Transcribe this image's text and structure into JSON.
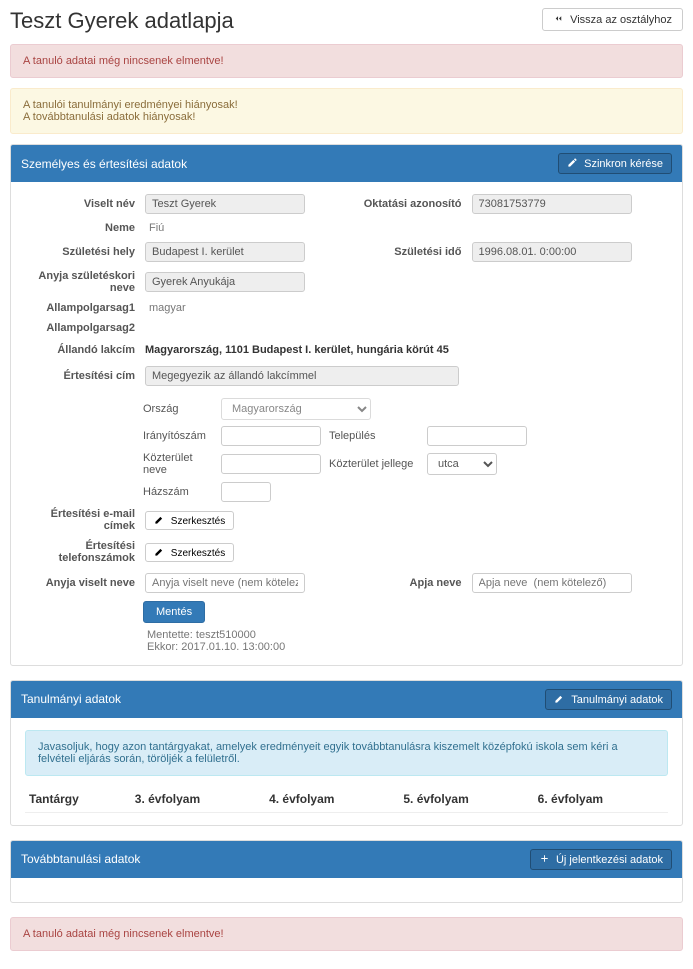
{
  "header": {
    "title": "Teszt Gyerek adatlapja",
    "back_btn": "Vissza az osztályhoz"
  },
  "alerts": {
    "not_saved": "A tanuló adatai még nincsenek elmentve!",
    "warn_line1": "A tanulói tanulmányi eredményei hiányosak!",
    "warn_line2": "A továbbtanulási adatok hiányosak!"
  },
  "personal": {
    "panel_title": "Személyes és értesítési adatok",
    "sync_btn": "Szinkron kérése",
    "labels": {
      "viselt_nev": "Viselt név",
      "oktatasi_azonosito": "Oktatási azonosító",
      "neme": "Neme",
      "szul_hely": "Születési hely",
      "szul_ido": "Születési idő",
      "anyja": "Anyja születéskori neve",
      "allampolg1": "Allampolgarsag1",
      "allampolg2": "Allampolgarsag2",
      "allando_lakcim": "Állandó lakcím",
      "ertesitesi_cim": "Értesítési cím",
      "email": "Értesítési e-mail címek",
      "tel": "Értesítési telefonszámok",
      "anyja_viselt": "Anyja viselt neve",
      "apja_neve": "Apja neve"
    },
    "values": {
      "viselt_nev": "Teszt Gyerek",
      "oktatasi_azonosito": "73081753779",
      "neme": "Fiú",
      "szul_hely": "Budapest I. kerület",
      "szul_ido": "1996.08.01. 0:00:00",
      "anyja": "Gyerek Anyukája",
      "allampolg1": "magyar",
      "allando_lakcim": "Magyarország, 1101 Budapest I. kerület, hungária körút 45",
      "ertesitesi_cim": "Megegyezik az állandó lakcímmel"
    },
    "address": {
      "orszag_label": "Ország",
      "orszag_value": "Magyarország",
      "iranyitoszam_label": "Irányítószám",
      "telepules_label": "Település",
      "kozterulet_neve_label": "Közterület neve",
      "kozterulet_jellege_label": "Közterület jellege",
      "kozterulet_jellege_value": "utca",
      "hazszam_label": "Házszám"
    },
    "placeholders": {
      "anyja_viselt": "Anyja viselt neve (nem kötelező)",
      "apja_neve": "Apja neve  (nem kötelező)"
    },
    "edit_btn": "Szerkesztés",
    "save_btn": "Mentés",
    "saved_by_label": "Mentette: teszt510000",
    "saved_at_label": "Ekkor: 2017.01.10. 13:00:00"
  },
  "study": {
    "panel_title": "Tanulmányi adatok",
    "panel_btn": "Tanulmányi adatok",
    "info": "Javasoljuk, hogy azon tantárgyakat, amelyek eredményeit egyik továbbtanulásra kiszemelt középfokú iskola sem kéri a felvételi eljárás során, töröljék a felületről.",
    "columns": {
      "subject": "Tantárgy",
      "g3": "3. évfolyam",
      "g4": "4. évfolyam",
      "g5": "5. évfolyam",
      "g6": "6. évfolyam"
    }
  },
  "further": {
    "panel_title": "Továbbtanulási adatok",
    "new_btn": "Új jelentkezési adatok"
  },
  "footer_alert": "A tanuló adatai még nincsenek elmentve!"
}
